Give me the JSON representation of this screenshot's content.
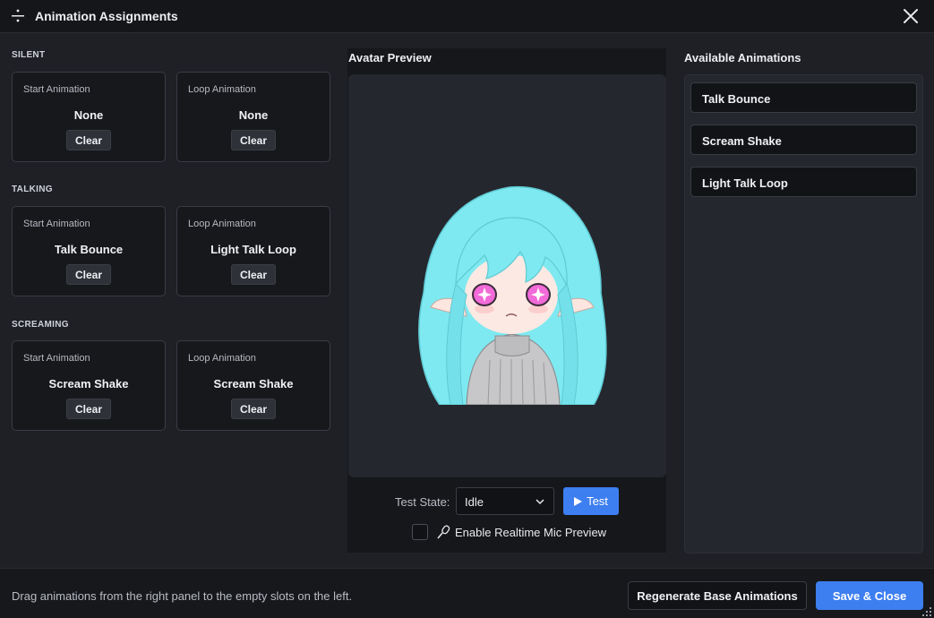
{
  "window": {
    "title": "Animation Assignments"
  },
  "sections": [
    {
      "label": "SILENT",
      "start": {
        "type": "Start Animation",
        "value": "None"
      },
      "loop": {
        "type": "Loop Animation",
        "value": "None"
      }
    },
    {
      "label": "TALKING",
      "start": {
        "type": "Start Animation",
        "value": "Talk Bounce"
      },
      "loop": {
        "type": "Loop Animation",
        "value": "Light Talk Loop"
      }
    },
    {
      "label": "SCREAMING",
      "start": {
        "type": "Start Animation",
        "value": "Scream Shake"
      },
      "loop": {
        "type": "Loop Animation",
        "value": "Scream Shake"
      }
    }
  ],
  "clear_label": "Clear",
  "preview": {
    "title": "Avatar Preview",
    "test_state_label": "Test State:",
    "test_state_value": "Idle",
    "test_button": "Test",
    "mic_label": "Enable Realtime Mic Preview",
    "mic_checked": false
  },
  "available": {
    "title": "Available Animations",
    "items": [
      "Talk Bounce",
      "Scream Shake",
      "Light Talk Loop"
    ]
  },
  "footer": {
    "hint": "Drag animations from the right panel to the empty slots on the left.",
    "regenerate": "Regenerate Base Animations",
    "save": "Save & Close"
  },
  "colors": {
    "accent": "#3d7ef0",
    "background": "#1e2026",
    "hair": "#7ee9f0",
    "eyes": "#f26ad8"
  },
  "icons": {
    "title": "drag-handle-icon",
    "close": "close-icon",
    "chevron": "chevron-down-icon",
    "play": "play-icon",
    "mic": "microphone-icon"
  }
}
